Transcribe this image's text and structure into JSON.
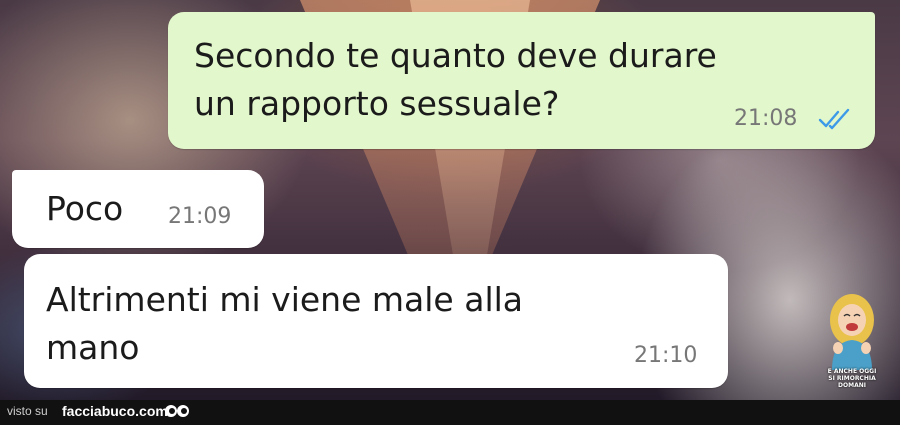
{
  "messages": [
    {
      "direction": "outgoing",
      "text": "Secondo te quanto deve durare\nun rapporto sessuale?",
      "time": "21:08",
      "status_icon": "double-check-read-icon",
      "status_color": "#3d9ae8"
    },
    {
      "direction": "incoming",
      "text": "Poco",
      "time": "21:09"
    },
    {
      "direction": "incoming",
      "text": "Altrimenti mi viene male alla\nmano",
      "time": "21:10"
    }
  ],
  "stamp": {
    "text": "E ANCHE OGGI\nSI RIMORCHIA DOMANI"
  },
  "footer": {
    "visto_label": "visto su",
    "site_label": "facciabuco.com",
    "logo_icon": "eyes-icon"
  },
  "colors": {
    "outgoing_bubble": "#e2f7cb",
    "incoming_bubble": "#ffffff",
    "footer_bg": "#111111"
  }
}
